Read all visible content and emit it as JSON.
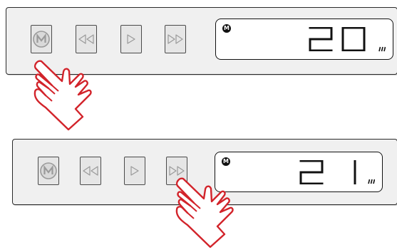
{
  "panels": [
    {
      "id": "top",
      "mode_badge": "M",
      "display_value": "20",
      "active_button": "mode-button"
    },
    {
      "id": "bottom",
      "mode_badge": "M",
      "display_value": "21",
      "active_button": "forward-button"
    }
  ],
  "buttons": [
    "mode-button",
    "rewind-button",
    "play-button",
    "forward-button"
  ],
  "colors": {
    "panel_bg": "#f0f0f0",
    "button_bg": "#e6e6e6",
    "outline": "#2a2a2a",
    "icon_gray": "#9a9a9a",
    "hand_red": "#d2232a"
  }
}
